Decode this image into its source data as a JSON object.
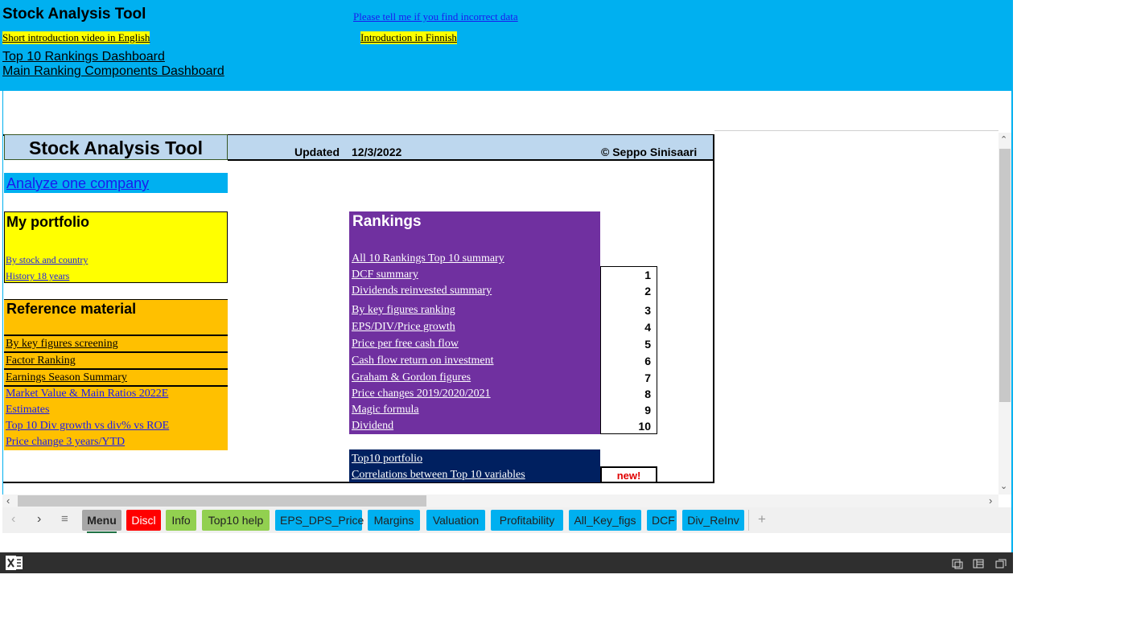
{
  "banner": {
    "title": "Stock Analysis Tool",
    "report_link": "Please tell me if you find incorrect data",
    "video_en": "Short introduction video in English",
    "video_fi": "Introduction in Finnish",
    "dashboard_top10": "Top 10 Rankings Dashboard",
    "dashboard_components": "Main Ranking Components Dashboard"
  },
  "header": {
    "title": "Stock Analysis Tool",
    "updated_label": "Updated",
    "updated_date": "12/3/2022",
    "copyright": "© Seppo Sinisaari"
  },
  "analyze_link": "Analyze one company",
  "portfolio": {
    "heading": "My portfolio",
    "links": [
      "By stock and country",
      "History 18 years"
    ]
  },
  "reference": {
    "heading": "Reference material",
    "links": [
      "By key figures screening",
      "Factor Ranking",
      "Earnings Season Summary",
      "Market Value & Main Ratios 2022E",
      "Estimates",
      "Top 10 Div growth vs div% vs ROE",
      "Price change 3 years/YTD"
    ]
  },
  "rankings": {
    "heading": "Rankings",
    "summary_link": "All  10 Rankings Top 10 summary",
    "items": [
      {
        "label": "DCF summary",
        "num": "1"
      },
      {
        "label": "Dividends reinvested summary",
        "num": "2"
      },
      {
        "label": "By key figures ranking",
        "num": "3"
      },
      {
        "label": "EPS/DIV/Price growth",
        "num": "4"
      },
      {
        "label": "Price per free cash flow",
        "num": "5"
      },
      {
        "label": "Cash flow return on investment",
        "num": "6"
      },
      {
        "label": "Graham & Gordon figures",
        "num": "7"
      },
      {
        "label": "Price changes 2019/2020/2021",
        "num": "8"
      },
      {
        "label": "Magic formula",
        "num": "9"
      },
      {
        "label": "Dividend",
        "num": "10"
      }
    ]
  },
  "top10": {
    "portfolio_link": "Top10 portfolio",
    "correlations_link": "Correlations between Top 10 variables",
    "new_badge": "new!"
  },
  "tabs": [
    {
      "label": "Menu",
      "color": "#a6a6a6"
    },
    {
      "label": "Discl",
      "color": "#ff0000"
    },
    {
      "label": "Info",
      "color": "#92d050"
    },
    {
      "label": "Top10 help",
      "color": "#92d050"
    },
    {
      "label": "EPS_DPS_Price",
      "color": "#00b0f0"
    },
    {
      "label": "Margins",
      "color": "#00b0f0"
    },
    {
      "label": "Valuation",
      "color": "#00b0f0"
    },
    {
      "label": "Profitability",
      "color": "#00b0f0"
    },
    {
      "label": "All_Key_figs",
      "color": "#00b0f0"
    },
    {
      "label": "DCF",
      "color": "#00b0f0"
    },
    {
      "label": "Div_ReInv",
      "color": "#00b0f0"
    }
  ],
  "tab_nav": {
    "add": "+"
  },
  "colors": {
    "banner": "#00b0f0",
    "rankings": "#7030a0",
    "top10": "#002060",
    "reference": "#ffc000",
    "portfolio": "#ffff00"
  }
}
